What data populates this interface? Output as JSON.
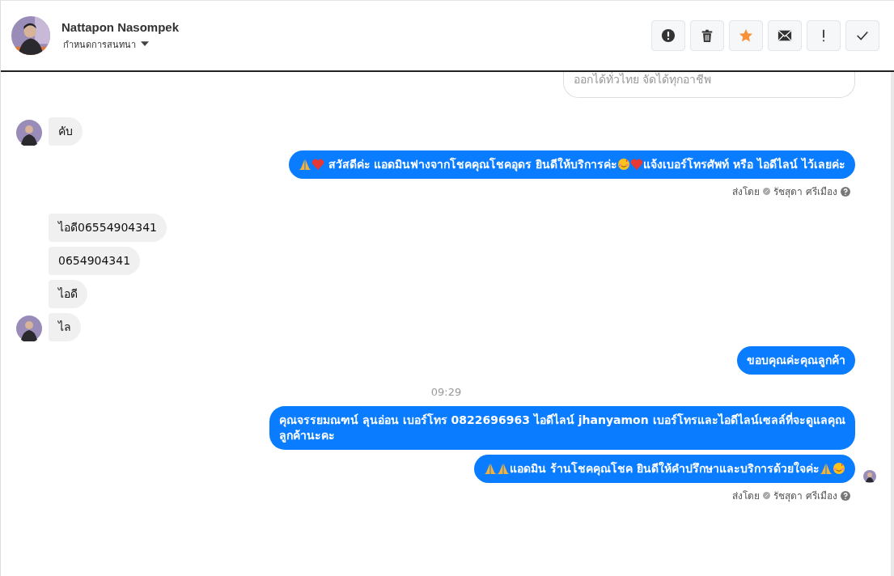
{
  "header": {
    "name": "Nattapon Nasompek",
    "subtitle": "กำหนดการสนทนา",
    "actions": [
      {
        "kind": "alert"
      },
      {
        "kind": "trash"
      },
      {
        "kind": "star"
      },
      {
        "kind": "mail"
      },
      {
        "kind": "exclaim"
      },
      {
        "kind": "check"
      }
    ]
  },
  "messages": [
    {
      "kind": "card",
      "parts": [
        {
          "kind": "text",
          "text": "ออกได้ทั่วไทย จัดได้ทุกอาชีพ"
        }
      ]
    },
    {
      "kind": "in",
      "avatar": true,
      "parts": [
        {
          "kind": "text",
          "text": "คับ"
        }
      ]
    },
    {
      "kind": "out",
      "seen": false,
      "parts": [
        {
          "kind": "pray"
        },
        {
          "kind": "heart"
        },
        {
          "kind": "text",
          "text": " สวัสดีค่ะ แอดมินฟางจากโชคคุณโชคอุดร ยินดีให้บริการค่ะ"
        },
        {
          "kind": "smile"
        },
        {
          "kind": "heart"
        },
        {
          "kind": "text",
          "text": "แจ้งเบอร์โทรศัพท์ หรือ ไอดีไลน์  ไว้เลยค่ะ"
        }
      ],
      "sent_by": {
        "label": "ส่งโดย",
        "name": "รัชสุดา ศรีเมือง"
      }
    },
    {
      "kind": "in",
      "avatar": false,
      "parts": [
        {
          "kind": "text",
          "text": "ไอดี06554904341"
        }
      ]
    },
    {
      "kind": "in",
      "avatar": false,
      "parts": [
        {
          "kind": "text",
          "text": "0654904341"
        }
      ]
    },
    {
      "kind": "in",
      "avatar": false,
      "parts": [
        {
          "kind": "text",
          "text": "ไอดี"
        }
      ]
    },
    {
      "kind": "in",
      "avatar": true,
      "parts": [
        {
          "kind": "text",
          "text": "ไล"
        }
      ]
    },
    {
      "kind": "out",
      "seen": false,
      "parts": [
        {
          "kind": "text",
          "text": "ขอบคุณค่ะคุณลูกค้า"
        }
      ]
    },
    {
      "kind": "time",
      "text": "09:29"
    },
    {
      "kind": "out",
      "seen": false,
      "parts": [
        {
          "kind": "text",
          "text": "คุณจรรยมณฑน์ ลุนอ่อน เบอร์โทร 0822696963  ไอดีไลน์  jhanyamon   เบอร์โทรและไอดีไลน์เซลล์ที่จะดูแลคุณลูกค้านะคะ"
        }
      ]
    },
    {
      "kind": "out",
      "seen": true,
      "parts": [
        {
          "kind": "pray"
        },
        {
          "kind": "pray"
        },
        {
          "kind": "text",
          "text": "แอดมิน ร้านโชคคุณโชค ยินดีให้คำปรึกษาและบริการด้วยใจค่ะ"
        },
        {
          "kind": "pray"
        },
        {
          "kind": "smile"
        }
      ],
      "sent_by": {
        "label": "ส่งโดย",
        "name": "รัชสุดา ศรีเมือง"
      }
    }
  ]
}
